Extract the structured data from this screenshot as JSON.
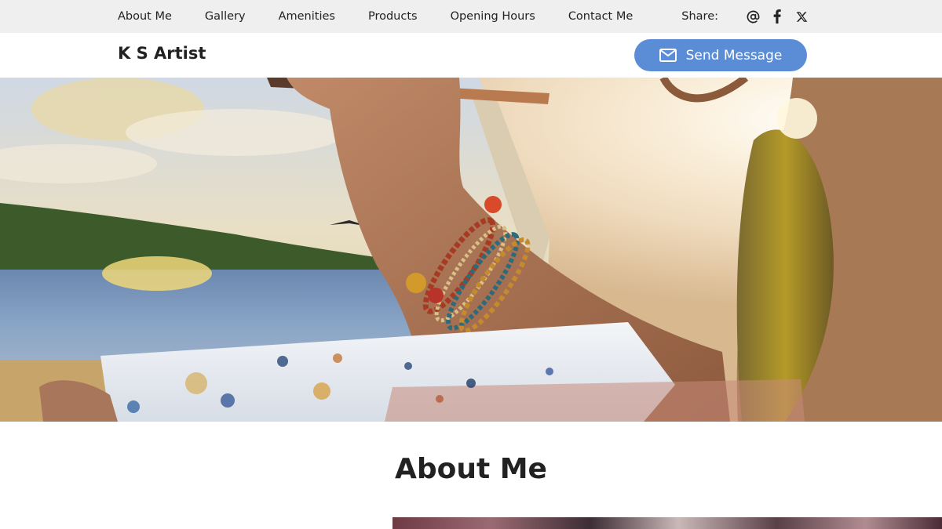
{
  "topbar": {
    "nav": [
      {
        "label": "About Me"
      },
      {
        "label": "Gallery"
      },
      {
        "label": "Amenities"
      },
      {
        "label": "Products"
      },
      {
        "label": "Opening Hours"
      },
      {
        "label": "Contact Me"
      }
    ],
    "share_label": "Share:",
    "share_icons": [
      "at-icon",
      "facebook-icon",
      "x-icon"
    ]
  },
  "header": {
    "brand": "K S Artist",
    "send_message_label": "Send Message",
    "send_message_icon": "mail-icon"
  },
  "about": {
    "title": "About Me"
  },
  "colors": {
    "accent": "#5b8cd6",
    "topbar_bg": "#efefef",
    "text": "#222222"
  }
}
